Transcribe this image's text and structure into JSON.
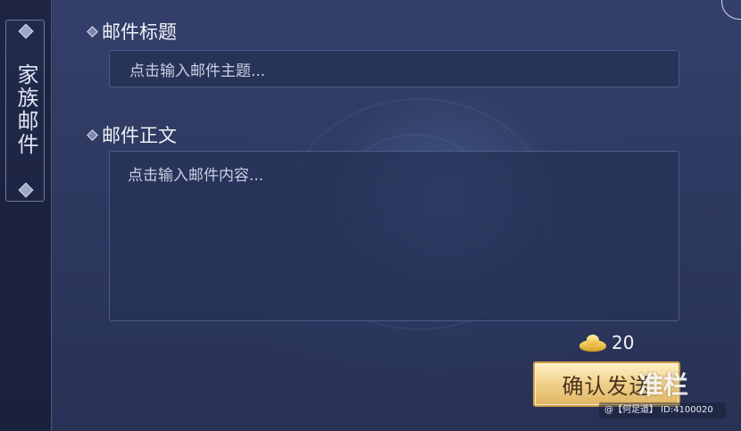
{
  "sidebar": {
    "tab_label": "家族邮件"
  },
  "mail": {
    "subject_label": "邮件标题",
    "subject_placeholder": "点击输入邮件主题...",
    "body_label": "邮件正文",
    "body_placeholder": "点击输入邮件内容..."
  },
  "cost": {
    "icon": "gold-ingot-icon",
    "value": "20"
  },
  "actions": {
    "confirm_label": "确认发送"
  },
  "watermark": {
    "logo_text": "准栏",
    "credit": "@【何足道】 ID:4100020"
  }
}
